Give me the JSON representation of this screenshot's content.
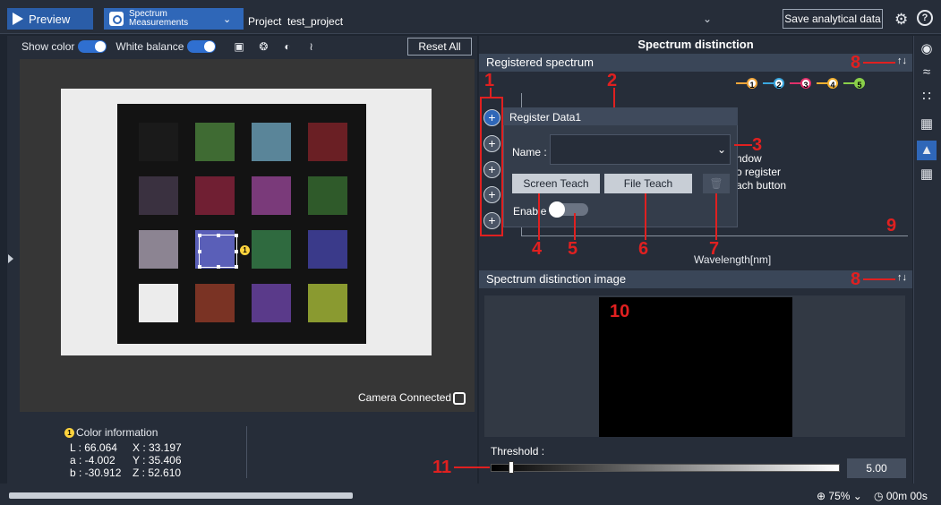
{
  "topbar": {
    "preview_label": "Preview",
    "tab_label_line1": "Spectrum",
    "tab_label_line2": "Measurements",
    "project_label": "Project",
    "project_name": "test_project",
    "save_label": "Save analytical data"
  },
  "left": {
    "show_color_label": "Show color",
    "white_balance_label": "White balance",
    "reset_label": "Reset All",
    "camera_status": "Camera Connected",
    "patch_colors": [
      "#1a1a1a",
      "#3f6b33",
      "#5a8599",
      "#6a1f24",
      "#3a3140",
      "#701f33",
      "#7a3a7a",
      "#2f5a2a",
      "#8c8492",
      "#5a5fb8",
      "#2f6a3f",
      "#3a3a8a",
      "#ececec",
      "#7a3324",
      "#5a3a8a",
      "#8a9a30"
    ],
    "selection_marker": "1",
    "color_info": {
      "title": "Color information",
      "marker": "1",
      "L": "L : 66.064",
      "a": "a : -4.002",
      "b": "b : -30.912",
      "X": "X : 33.197",
      "Y": "Y : 35.406",
      "Z": "Z : 52.610"
    }
  },
  "bottombar": {
    "zoom": "75%",
    "timer": "00m 00s"
  },
  "right": {
    "title": "Spectrum distinction",
    "registered_header": "Registered spectrum",
    "xlabel": "Wavelength[nm]",
    "legend": [
      {
        "n": "1",
        "color": "#f2a63a"
      },
      {
        "n": "2",
        "color": "#3aa8e0"
      },
      {
        "n": "3",
        "color": "#e0306a"
      },
      {
        "n": "4",
        "color": "#f2b030"
      },
      {
        "n": "5",
        "color": "#8ad04a"
      }
    ],
    "popup": {
      "title": "Register Data1",
      "name_label": "Name :",
      "name_value": "",
      "screen_teach": "Screen Teach",
      "file_teach": "File Teach",
      "enable_label": "Enable"
    },
    "hint_lines": [
      "ndow",
      "o register",
      "ach button"
    ],
    "distinction_header": "Spectrum distinction image",
    "threshold_label": "Threshold :",
    "threshold_value": "5.00",
    "threshold_level": 0.05
  },
  "annotations": [
    "1",
    "2",
    "3",
    "4",
    "5",
    "6",
    "7",
    "8",
    "8",
    "9",
    "10",
    "11"
  ]
}
